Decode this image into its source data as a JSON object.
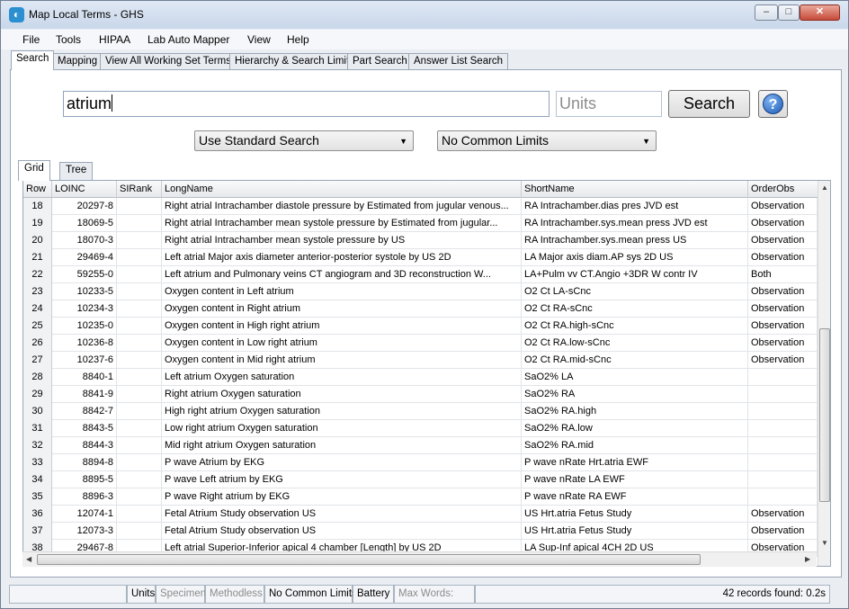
{
  "window": {
    "title": "Map Local Terms - GHS"
  },
  "menu": [
    "File",
    "Tools",
    "HIPAA",
    "Lab Auto Mapper",
    "View",
    "Help"
  ],
  "tabs": [
    "Search",
    "Mapping",
    "View All Working Set Terms",
    "Hierarchy & Search Limits",
    "Part Search",
    "Answer List Search"
  ],
  "search": {
    "query": "atrium",
    "units_placeholder": "Units",
    "button": "Search",
    "help_icon": "?",
    "mode": "Use Standard Search",
    "limits": "No Common Limits"
  },
  "view_tabs": [
    "Grid",
    "Tree"
  ],
  "grid": {
    "columns": [
      "Row",
      "LOINC",
      "SIRank",
      "LongName",
      "ShortName",
      "OrderObs"
    ],
    "rows": [
      [
        "18",
        "20297-8",
        "",
        "Right atrial Intrachamber diastole pressure by Estimated from jugular venous...",
        "RA Intrachamber.dias pres JVD est",
        "Observation"
      ],
      [
        "19",
        "18069-5",
        "",
        "Right atrial Intrachamber mean systole pressure by Estimated from jugular...",
        "RA Intrachamber.sys.mean press JVD est",
        "Observation"
      ],
      [
        "20",
        "18070-3",
        "",
        "Right atrial Intrachamber mean systole pressure by US",
        "RA Intrachamber.sys.mean press US",
        "Observation"
      ],
      [
        "21",
        "29469-4",
        "",
        "Left atrial Major axis diameter anterior-posterior systole by US 2D",
        "LA Major axis diam.AP sys 2D US",
        "Observation"
      ],
      [
        "22",
        "59255-0",
        "",
        "Left atrium and Pulmonary veins CT angiogram and 3D reconstruction W...",
        "LA+Pulm vv CT.Angio +3DR W contr IV",
        "Both"
      ],
      [
        "23",
        "10233-5",
        "",
        "Oxygen content in Left atrium",
        "O2 Ct LA-sCnc",
        "Observation"
      ],
      [
        "24",
        "10234-3",
        "",
        "Oxygen content in Right atrium",
        "O2 Ct RA-sCnc",
        "Observation"
      ],
      [
        "25",
        "10235-0",
        "",
        "Oxygen content in High right atrium",
        "O2 Ct RA.high-sCnc",
        "Observation"
      ],
      [
        "26",
        "10236-8",
        "",
        "Oxygen content in Low right atrium",
        "O2 Ct RA.low-sCnc",
        "Observation"
      ],
      [
        "27",
        "10237-6",
        "",
        "Oxygen content in Mid right atrium",
        "O2 Ct RA.mid-sCnc",
        "Observation"
      ],
      [
        "28",
        "8840-1",
        "",
        "Left atrium Oxygen saturation",
        "SaO2% LA",
        ""
      ],
      [
        "29",
        "8841-9",
        "",
        "Right atrium Oxygen saturation",
        "SaO2% RA",
        ""
      ],
      [
        "30",
        "8842-7",
        "",
        "High right atrium Oxygen saturation",
        "SaO2% RA.high",
        ""
      ],
      [
        "31",
        "8843-5",
        "",
        "Low right atrium Oxygen saturation",
        "SaO2% RA.low",
        ""
      ],
      [
        "32",
        "8844-3",
        "",
        "Mid right atrium Oxygen saturation",
        "SaO2% RA.mid",
        ""
      ],
      [
        "33",
        "8894-8",
        "",
        "P wave Atrium by EKG",
        "P wave nRate Hrt.atria EWF",
        ""
      ],
      [
        "34",
        "8895-5",
        "",
        "P wave Left atrium by EKG",
        "P wave nRate LA EWF",
        ""
      ],
      [
        "35",
        "8896-3",
        "",
        "P wave Right atrium by EKG",
        "P wave nRate RA EWF",
        ""
      ],
      [
        "36",
        "12074-1",
        "",
        "Fetal Atrium Study observation US",
        "US Hrt.atria Fetus Study",
        "Observation"
      ],
      [
        "37",
        "12073-3",
        "",
        "Fetal Atrium Study observation US",
        "US Hrt.atria Fetus Study",
        "Observation"
      ],
      [
        "38",
        "29467-8",
        "",
        "Left atrial Superior-Inferior apical 4 chamber [Length] by US 2D",
        "LA Sup-Inf apical 4CH 2D US",
        "Observation"
      ]
    ]
  },
  "status": {
    "units": "Units",
    "specimen": "Specimen",
    "methodless": "Methodless",
    "limits": "No Common Limits",
    "battery": "Battery",
    "max_words": "Max Words:",
    "records": "42 records found: 0.2s"
  },
  "colors": {
    "accent": "#1e5cb8",
    "close": "#c74a38"
  }
}
